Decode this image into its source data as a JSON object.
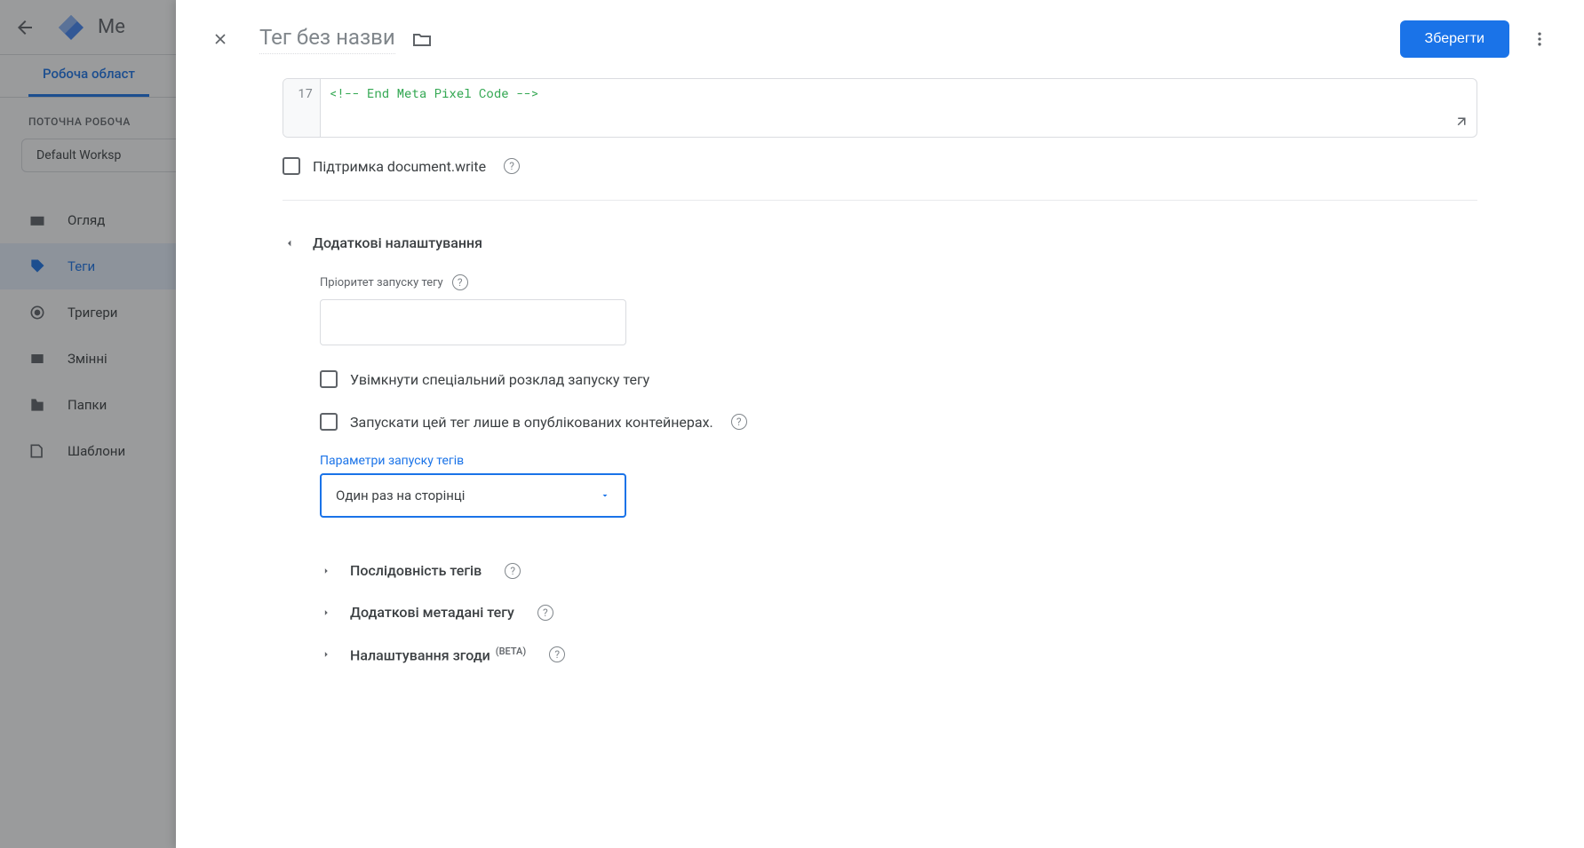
{
  "bg": {
    "title": "Me",
    "tab": "Робоча област",
    "section_label": "ПОТОЧНА РОБОЧА",
    "workspace": "Default Worksp",
    "nav": {
      "overview": "Огляд",
      "tags": "Теги",
      "triggers": "Тригери",
      "variables": "Змінні",
      "folders": "Папки",
      "templates": "Шаблони"
    }
  },
  "modal": {
    "title": "Тег без назви",
    "save": "Зберегти",
    "code_line_num": "17",
    "code_content": "<!-- End Meta Pixel Code -->",
    "support_doc_write": "Підтримка document.write",
    "additional_settings": "Додаткові налаштування",
    "priority_label": "Пріоритет запуску тегу",
    "enable_schedule": "Увімкнути спеціальний розклад запуску тегу",
    "published_only": "Запускати цей тег лише в опублікованих контейнерах.",
    "firing_params_label": "Параметри запуску тегів",
    "firing_option": "Один раз на сторінці",
    "seq": "Послідовність тегів",
    "metadata": "Додаткові метадані тегу",
    "consent": "Налаштування згоди",
    "beta": "(BETA)"
  }
}
